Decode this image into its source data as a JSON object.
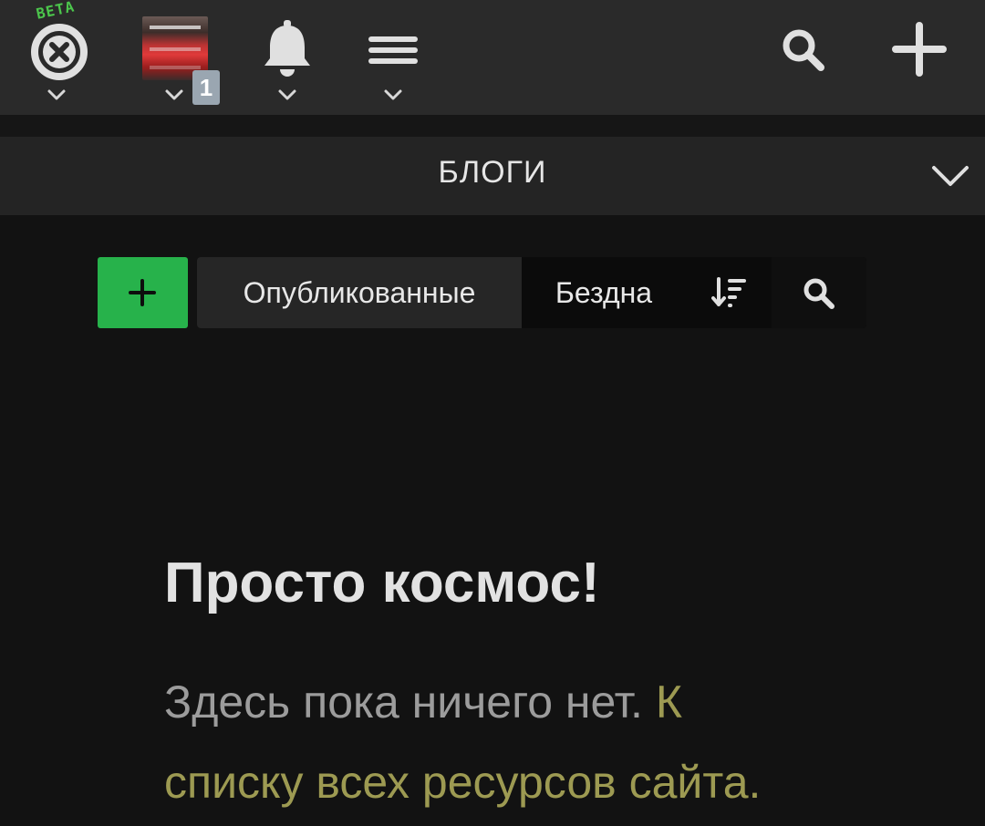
{
  "topbar": {
    "beta_label": "BETA",
    "notification_count": "1",
    "icons": [
      "close-circle-icon",
      "avatar",
      "bell-icon",
      "menu-icon",
      "search-icon",
      "plus-icon"
    ]
  },
  "section": {
    "title": "БЛОГИ"
  },
  "toolbar": {
    "add_label": "+",
    "tabs": [
      {
        "label": "Опубликованные",
        "active": true
      },
      {
        "label": "Бездна",
        "active": false
      }
    ]
  },
  "empty_state": {
    "title": "Просто космос!",
    "text": "Здесь пока ничего нет. ",
    "link": "К списку всех ресурсов сайта."
  },
  "colors": {
    "topbar_bg": "#2a2a2a",
    "page_bg": "#121212",
    "accent_green": "#27b24b",
    "beta_green": "#4cc64c",
    "link_olive": "#9d9a52",
    "badge_gray": "#9aa6b1"
  }
}
